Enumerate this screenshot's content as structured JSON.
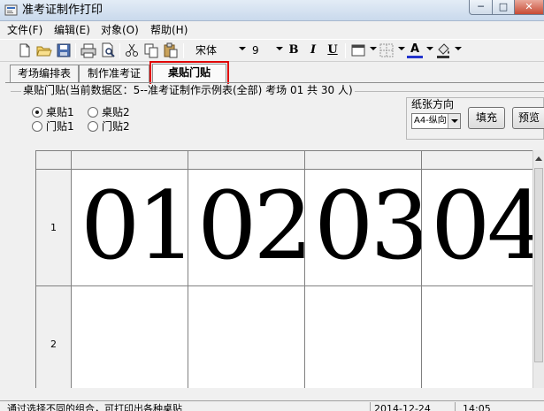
{
  "window": {
    "title": "准考证制作打印",
    "minimize_icon": "minimize-icon",
    "maximize_icon": "maximize-icon",
    "close_icon": "close-icon"
  },
  "menu": [
    {
      "label": "文件(F)"
    },
    {
      "label": "编辑(E)"
    },
    {
      "label": "对象(O)"
    },
    {
      "label": "帮助(H)"
    }
  ],
  "toolbar": {
    "font_name": "宋体",
    "font_size": "9",
    "bold_label": "B",
    "italic_label": "I",
    "underline_label": "U",
    "font_color_label": "A"
  },
  "tabs": [
    {
      "label": "考场编排表",
      "active": false
    },
    {
      "label": "制作准考证",
      "active": false
    },
    {
      "label": "桌贴门贴",
      "active": true
    }
  ],
  "panel": {
    "group_title": "桌贴门贴(当前数据区：5--准考证制作示例表(全部)  考场 01 共 30 人)",
    "radios": [
      {
        "label": "桌贴1",
        "checked": true
      },
      {
        "label": "桌贴2",
        "checked": false
      },
      {
        "label": "门贴1",
        "checked": false
      },
      {
        "label": "门贴2",
        "checked": false
      }
    ],
    "paper_orientation_title": "纸张方向",
    "paper_value": "A4-纵向",
    "fill_button": "填充",
    "preview_button": "预览打"
  },
  "grid": {
    "rows": [
      {
        "label": "1",
        "cells": [
          "01",
          "02",
          "03",
          "04"
        ]
      },
      {
        "label": "2",
        "cells": [
          "",
          "",
          "",
          ""
        ]
      }
    ]
  },
  "status": {
    "message": "通过选择不同的组合，可打印出各种桌贴",
    "date": "2014-12-24",
    "time": "14:05"
  }
}
